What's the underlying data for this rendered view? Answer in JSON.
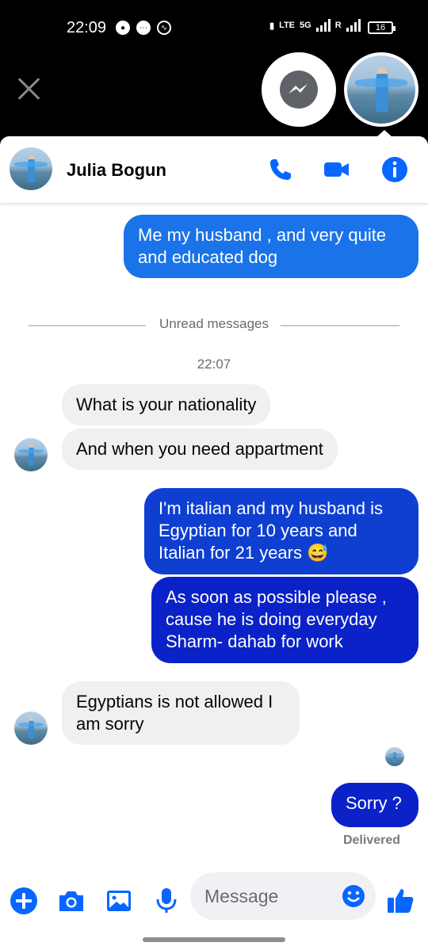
{
  "status_bar": {
    "time": "22:09",
    "network": "5G",
    "battery": "16"
  },
  "chat": {
    "contact_name": "Julia Bogun"
  },
  "messages": {
    "m1": "Me my husband , and very quite and educated dog",
    "unread_label": "Unread messages",
    "timestamp": "22:07",
    "m2": "What is your nationality",
    "m3": "And when you need appartment",
    "m4": "I'm italian and my husband is Egyptian for 10 years and Italian for 21 years 😅",
    "m5": "As soon as possible please , cause he is doing everyday Sharm- dahab for work",
    "m6": "Egyptians is not allowed I am sorry",
    "m7": "Sorry ?",
    "delivered": "Delivered"
  },
  "composer": {
    "placeholder": "Message"
  },
  "colors": {
    "accent": "#0866ff",
    "bubble_light": "#1a73e8",
    "bubble_deep": "#0a22c8",
    "incoming": "#f0f0f3"
  }
}
